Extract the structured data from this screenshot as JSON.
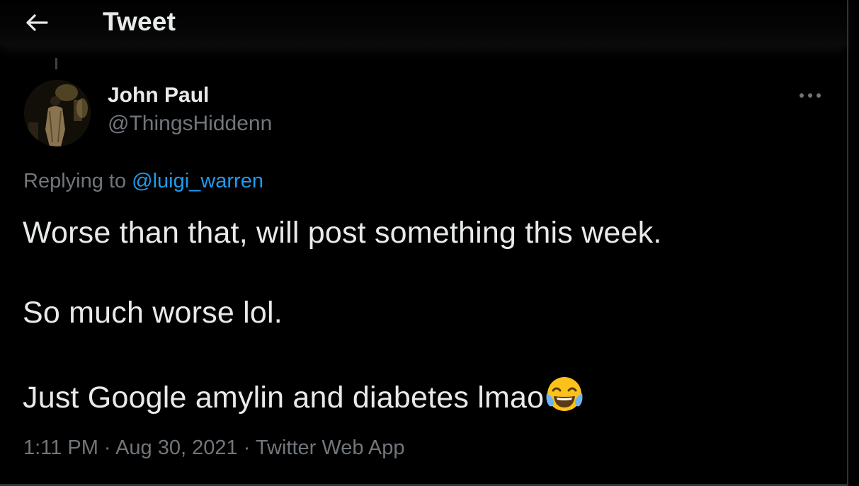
{
  "header": {
    "title": "Tweet",
    "back_icon": "arrow-left-icon"
  },
  "tweet": {
    "author": {
      "display_name": "John Paul",
      "handle": "@ThingsHiddenn"
    },
    "more_icon": "more-horizontal-icon",
    "replying_prefix": "Replying to",
    "replying_to": "@luigi_warren",
    "lines": [
      "Worse than that, will post something this week.",
      "So much worse lol.",
      "Just Google amylin and diabetes lmao"
    ],
    "emoji": "face-with-tears-of-joy",
    "time": "1:11 PM",
    "separator": "·",
    "date": "Aug 30, 2021",
    "source": "Twitter Web App"
  },
  "colors": {
    "background": "#000000",
    "text": "#e7e9ea",
    "muted": "#71767b",
    "link": "#1d9bf0"
  }
}
